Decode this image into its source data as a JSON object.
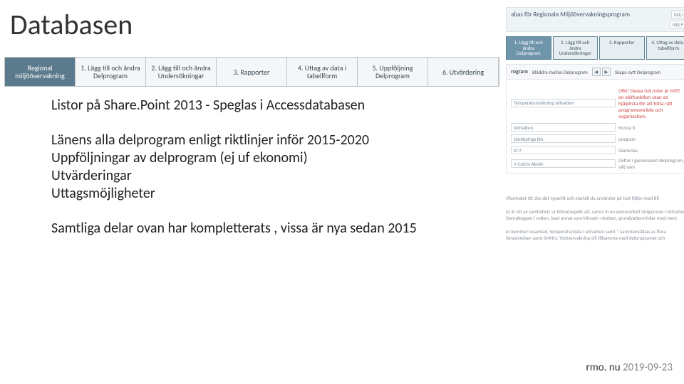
{
  "title": "Databasen",
  "nav": [
    "Regional\nmiljöövervakning",
    "1. Lägg till och ändra\nDelprogram",
    "2. Lägg till och ändra\nUndersökningar",
    "3. Rapporter",
    "4. Uttag av data i\ntabellform",
    "5. Uppföljning\nDelprogram",
    "6. Utvärdering"
  ],
  "body": {
    "l1": "Listor på Share.Point 2013 - Speglas i Accessdatabasen",
    "l2": "Länens alla delprogram enligt riktlinjer inför 2015-2020",
    "l3": "Uppföljningar av delprogram (ej uf ekonomi)",
    "l4": "Utvärderingar",
    "l5": "Uttagsmöjligheter",
    "l6": "Samtliga delar ovan har kompletterats , vissa är nya sedan 2015"
  },
  "preview": {
    "bar_title": "abas för Regionala Miljöövervakningsprogram",
    "select1": "Välj l",
    "select2": "Välj P",
    "ribbon": [
      "1. Lägg till och ändra\nDelprogram",
      "2. Lägg till och ändra\nUndersökningar",
      "3. Rapporter",
      "4. Uttag av data i\ntabellform"
    ],
    "section_title": "rogram",
    "browse_label": "Bläddra mellan Delprogram",
    "create_label": "Skapa nytt Delprogram",
    "field1": "Temperaturmätning sötvatten",
    "field2": "Sötvatten",
    "field3": "Jönköpings län",
    "field4": "ST F",
    "field5": "n-Catrin Almér",
    "obs": "OBS! Dessa två rutor är INTE en sökfunktion utan en hjälplista för att hitta rätt programområde och organisation.",
    "side1": "Kryssa h",
    "side2": "program",
    "side3": "Gemensa",
    "side4": "Deltar i gemensamt delprogram, välj sam",
    "note1": "Vformatet rtf, dvs det typsnitt och storlek du använder på text följer med till",
    "note2": "et är ett av samhällets ur klimataspekt att, samla in en sammanfatt  ningsinnen i sötvatten. (tempkoggen i vatten, kan) annat som klimatn  «tratten, grundvattennivåer med mer).",
    "note3": "et kommer insamlad, temperaturdata i sötvatten samt * sammanställas av flera länsstyrelser samt SMHI:s 'tioövervakning vill tillsamma med delprogramet och"
  },
  "footer": {
    "site": "rmo. nu",
    "date": "2019-09-23"
  }
}
